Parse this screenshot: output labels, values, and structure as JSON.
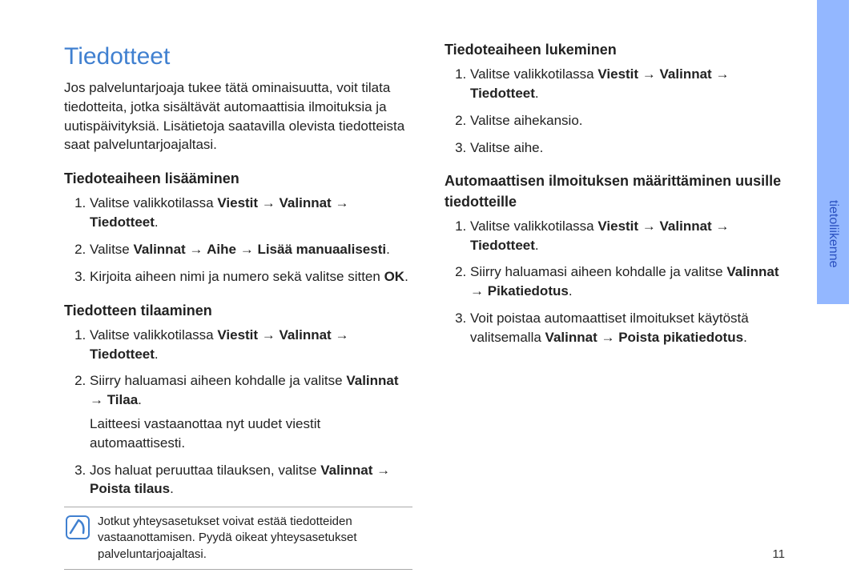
{
  "pageNumber": "11",
  "sideTab": "tietoliikenne",
  "title": "Tiedotteet",
  "intro": "Jos palveluntarjoaja tukee tätä ominaisuutta, voit tilata tiedotteita, jotka sisältävät automaattisia ilmoituksia ja uutispäivityksiä. Lisätietoja saatavilla olevista tiedotteista saat palveluntarjoajaltasi.",
  "sections": {
    "add": {
      "heading": "Tiedoteaiheen lisääminen",
      "step1_a": "Valitse valikkotilassa ",
      "step1_b": "Viestit",
      "step1_c": " → ",
      "step1_d": "Valinnat",
      "step1_e": " → ",
      "step1_f": "Tiedotteet",
      "step1_g": ".",
      "step2_a": "Valitse ",
      "step2_b": "Valinnat",
      "step2_c": " → ",
      "step2_d": "Aihe",
      "step2_e": " → ",
      "step2_f": "Lisää manuaalisesti",
      "step2_g": ".",
      "step3_a": "Kirjoita aiheen nimi ja numero sekä valitse sitten ",
      "step3_b": "OK",
      "step3_c": "."
    },
    "order": {
      "heading": "Tiedotteen tilaaminen",
      "step1_a": "Valitse valikkotilassa ",
      "step1_b": "Viestit",
      "step1_c": " → ",
      "step1_d": "Valinnat",
      "step1_e": " → ",
      "step1_f": "Tiedotteet",
      "step1_g": ".",
      "step2_a": "Siirry haluamasi aiheen kohdalle ja valitse ",
      "step2_b": "Valinnat",
      "step2_c": " → ",
      "step2_d": "Tilaa",
      "step2_e": ".",
      "note": "Laitteesi vastaanottaa nyt uudet viestit automaattisesti.",
      "step3_a": "Jos haluat peruuttaa tilauksen, valitse ",
      "step3_b": "Valinnat",
      "step3_c": " → ",
      "step3_d": "Poista tilaus",
      "step3_e": "."
    },
    "infoBox": "Jotkut yhteysasetukset voivat estää tiedotteiden vastaanottamisen. Pyydä oikeat yhteysasetukset palveluntarjoajaltasi.",
    "read": {
      "heading": "Tiedoteaiheen lukeminen",
      "step1_a": "Valitse valikkotilassa ",
      "step1_b": "Viestit",
      "step1_c": " → ",
      "step1_d": "Valinnat",
      "step1_e": " → ",
      "step1_f": "Tiedotteet",
      "step1_g": ".",
      "step2": "Valitse aihekansio.",
      "step3": "Valitse aihe."
    },
    "auto": {
      "heading": "Automaattisen ilmoituksen määrittäminen uusille tiedotteille",
      "step1_a": "Valitse valikkotilassa ",
      "step1_b": "Viestit",
      "step1_c": " → ",
      "step1_d": "Valinnat",
      "step1_e": " → ",
      "step1_f": "Tiedotteet",
      "step1_g": ".",
      "step2_a": "Siirry haluamasi aiheen kohdalle ja valitse ",
      "step2_b": "Valinnat",
      "step2_c": " → ",
      "step2_d": "Pikatiedotus",
      "step2_e": ".",
      "step3_a": "Voit poistaa automaattiset ilmoitukset käytöstä valitsemalla ",
      "step3_b": "Valinnat",
      "step3_c": " → ",
      "step3_d": "Poista pikatiedotus",
      "step3_e": "."
    }
  }
}
